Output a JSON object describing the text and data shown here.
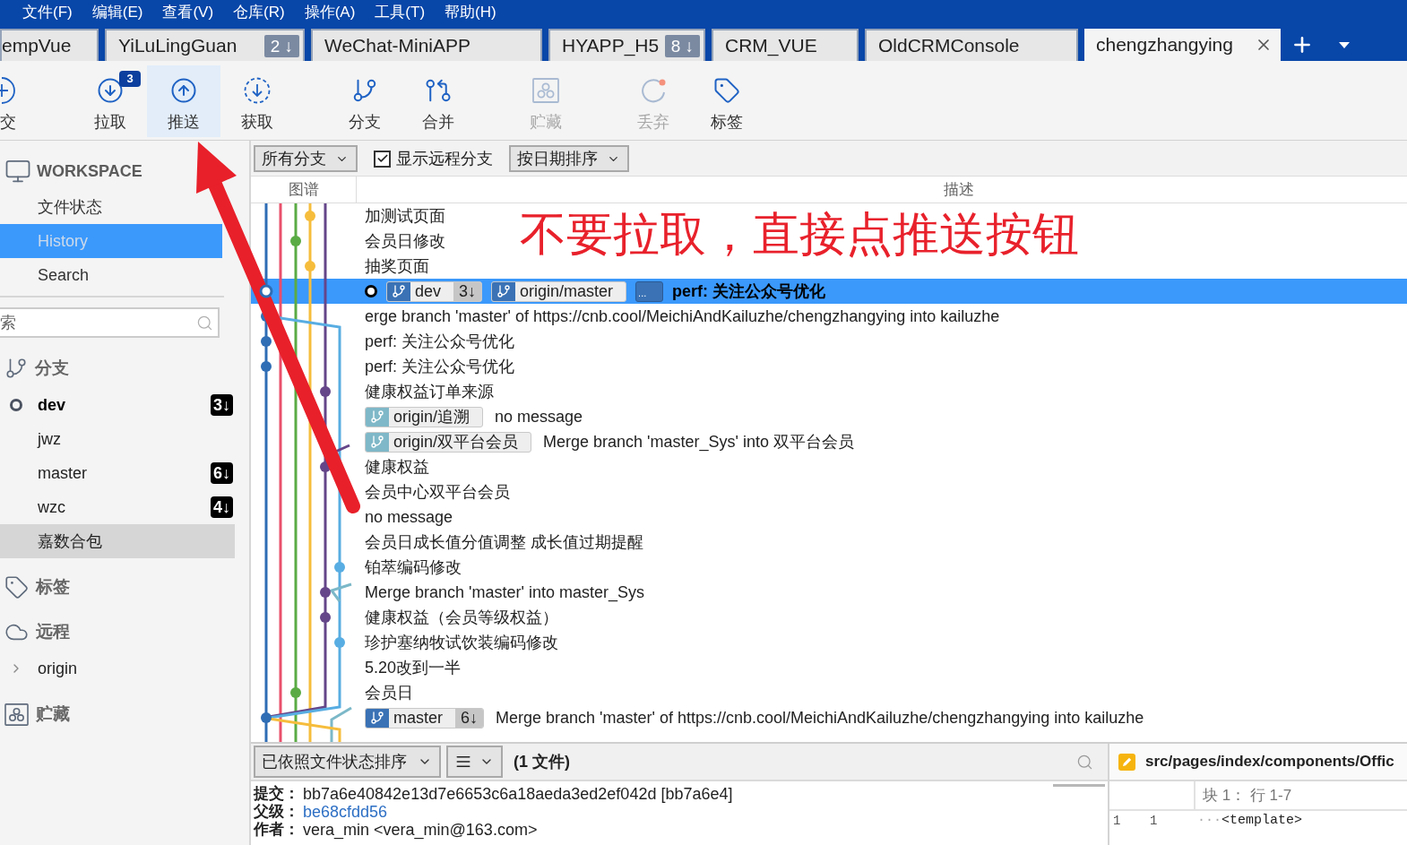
{
  "menu": [
    "文件(F)",
    "编辑(E)",
    "查看(V)",
    "仓库(R)",
    "操作(A)",
    "工具(T)",
    "帮助(H)"
  ],
  "tabs": [
    {
      "label": "empVue",
      "selected": false
    },
    {
      "label": "YiLuLingGuan",
      "badge": "2 ↓",
      "selected": false
    },
    {
      "label": "WeChat-MiniAPP",
      "selected": false
    },
    {
      "label": "HYAPP_H5",
      "badge": "8 ↓",
      "selected": false
    },
    {
      "label": "CRM_VUE",
      "selected": false
    },
    {
      "label": "OldCRMConsole",
      "selected": false
    },
    {
      "label": "chengzhangying",
      "selected": true
    }
  ],
  "toolbar": [
    {
      "kind": "commit",
      "label": "交",
      "hovered": false,
      "disabled": false
    },
    {
      "kind": "pull",
      "label": "拉取",
      "badge": "3",
      "hovered": false,
      "disabled": false
    },
    {
      "kind": "push",
      "label": "推送",
      "hovered": true,
      "disabled": false
    },
    {
      "kind": "fetch",
      "label": "获取",
      "hovered": false,
      "disabled": false
    },
    {
      "kind": "branch",
      "label": "分支",
      "hovered": false,
      "disabled": false
    },
    {
      "kind": "merge",
      "label": "合并",
      "hovered": false,
      "disabled": false
    },
    {
      "kind": "stash",
      "label": "贮藏",
      "hovered": false,
      "disabled": true
    },
    {
      "kind": "discard",
      "label": "丢弃",
      "hovered": false,
      "disabled": true
    },
    {
      "kind": "tag",
      "label": "标签",
      "hovered": false,
      "disabled": false
    }
  ],
  "sidebar": {
    "workspace": {
      "title": "WORKSPACE",
      "items": [
        {
          "label": "文件状态",
          "selected": false
        },
        {
          "label": "History",
          "selected": true
        },
        {
          "label": "Search",
          "selected": false
        }
      ]
    },
    "search": {
      "placeholder": "索"
    },
    "sections": [
      {
        "kind": "branches",
        "title": "分支",
        "items": [
          {
            "label": "dev",
            "current": true,
            "badge": "3↓",
            "selected": false
          },
          {
            "label": "jwz",
            "current": false,
            "selected": false
          },
          {
            "label": "master",
            "current": false,
            "badge": "6↓",
            "selected": false
          },
          {
            "label": "wzc",
            "current": false,
            "badge": "4↓",
            "selected": false
          },
          {
            "label": "嘉数合包",
            "current": false,
            "selected": true
          }
        ]
      },
      {
        "kind": "tags",
        "title": "标签"
      },
      {
        "kind": "remotes",
        "title": "远程",
        "items": [
          {
            "label": "origin",
            "expanded": false,
            "selected": false
          }
        ]
      },
      {
        "kind": "stashes",
        "title": "贮藏"
      }
    ]
  },
  "filters": [
    {
      "kind": "dropdown",
      "label": "所有分支"
    },
    {
      "kind": "checkbox",
      "label": "显示远程分支",
      "checked": true
    },
    {
      "kind": "dropdown",
      "label": "按日期排序"
    }
  ],
  "columns": [
    "图谱",
    "描述"
  ],
  "commits": [
    {
      "message": "加测试页面",
      "selected": false,
      "head": false
    },
    {
      "message": "会员日修改",
      "selected": false,
      "head": false
    },
    {
      "message": "抽奖页面",
      "selected": false,
      "head": false
    },
    {
      "message": "perf: 关注公众号优化",
      "selected": true,
      "head": true,
      "refs": [
        {
          "kind": "branch",
          "label": "dev",
          "count": "3↓",
          "color": "#3a72b5"
        },
        {
          "kind": "branch",
          "label": "origin/master",
          "color": "#3a72b5"
        },
        {
          "kind": "more",
          "label": "..."
        }
      ]
    },
    {
      "message": "erge branch 'master' of https://cnb.cool/MeichiAndKailuzhe/chengzhangying into kailuzhe",
      "selected": false,
      "head": false
    },
    {
      "message": "perf: 关注公众号优化",
      "selected": false,
      "head": false
    },
    {
      "message": "perf: 关注公众号优化",
      "selected": false,
      "head": false
    },
    {
      "message": "健康权益订单来源",
      "selected": false,
      "head": false
    },
    {
      "message": "no message",
      "selected": false,
      "head": false,
      "refs": [
        {
          "kind": "branch",
          "label": "origin/追溯",
          "color": "#7fb8c8"
        }
      ]
    },
    {
      "message": "Merge branch 'master_Sys' into 双平台会员",
      "selected": false,
      "head": false,
      "refs": [
        {
          "kind": "branch",
          "label": "origin/双平台会员",
          "color": "#7fb8c8"
        }
      ]
    },
    {
      "message": "健康权益",
      "selected": false,
      "head": false
    },
    {
      "message": "会员中心双平台会员",
      "selected": false,
      "head": false
    },
    {
      "message": "no message",
      "selected": false,
      "head": false
    },
    {
      "message": "会员日成长值分值调整 成长值过期提醒",
      "selected": false,
      "head": false
    },
    {
      "message": "铂萃编码修改",
      "selected": false,
      "head": false
    },
    {
      "message": "Merge branch 'master' into master_Sys",
      "selected": false,
      "head": false
    },
    {
      "message": "健康权益（会员等级权益）",
      "selected": false,
      "head": false
    },
    {
      "message": "珍护塞纳牧试饮装编码修改",
      "selected": false,
      "head": false
    },
    {
      "message": "5.20改到一半",
      "selected": false,
      "head": false
    },
    {
      "message": "会员日",
      "selected": false,
      "head": false
    },
    {
      "message": "Merge branch 'master' of https://cnb.cool/MeichiAndKailuzhe/chengzhangying into kailuzhe",
      "selected": false,
      "head": false,
      "refs": [
        {
          "kind": "branch",
          "label": "master",
          "count": "6↓",
          "color": "#3a72b5"
        }
      ]
    }
  ],
  "annotation": {
    "text": "不要拉取，直接点推送按钮"
  },
  "changes": {
    "sort": "已依照文件状态排序",
    "count": "(1 文件)"
  },
  "details": [
    {
      "kind": "text",
      "label": "提交：",
      "value": "bb7a6e40842e13d7e6653c6a18aeda3ed2ef042d [bb7a6e4]"
    },
    {
      "kind": "link",
      "label": "父级：",
      "value": "be68cfdd56"
    },
    {
      "kind": "text",
      "label": "作者：",
      "value": "vera_min <vera_min@163.com>"
    }
  ],
  "diff": {
    "file": "src/pages/index/components/Offic",
    "hunk": "块 1： 行 1-7",
    "lines": [
      {
        "old": "1",
        "new": "1",
        "indent": "···",
        "code": "<template>"
      }
    ]
  }
}
